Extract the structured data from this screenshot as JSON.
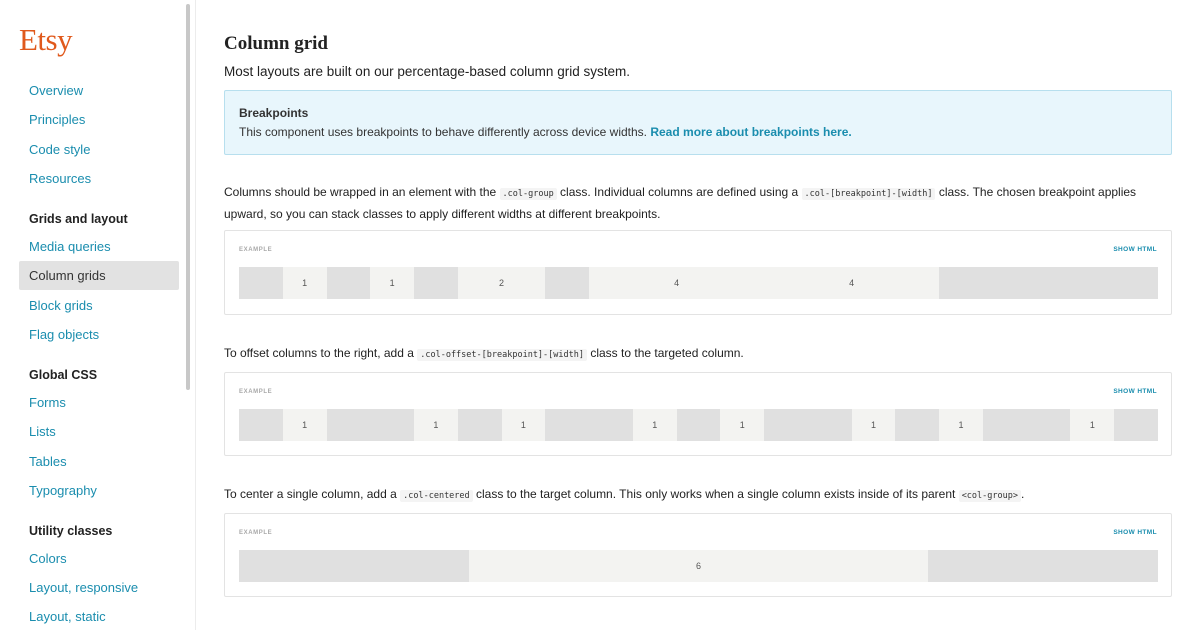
{
  "sidebar": {
    "logo": "Etsy",
    "nav_top": [
      {
        "label": "Overview"
      },
      {
        "label": "Principles"
      },
      {
        "label": "Code style"
      },
      {
        "label": "Resources"
      }
    ],
    "heading_grids": "Grids and layout",
    "nav_grids": [
      {
        "label": "Media queries"
      },
      {
        "label": "Column grids"
      },
      {
        "label": "Block grids"
      },
      {
        "label": "Flag objects"
      }
    ],
    "heading_css": "Global CSS",
    "nav_css": [
      {
        "label": "Forms"
      },
      {
        "label": "Lists"
      },
      {
        "label": "Tables"
      },
      {
        "label": "Typography"
      }
    ],
    "heading_utility": "Utility classes",
    "nav_utility": [
      {
        "label": "Colors"
      },
      {
        "label": "Layout, responsive"
      },
      {
        "label": "Layout, static"
      }
    ]
  },
  "main": {
    "title": "Column grid",
    "intro": "Most layouts are built on our percentage-based column grid system.",
    "callout": {
      "title": "Breakpoints",
      "body": "This component uses breakpoints to behave differently across device widths.",
      "link": "Read more about breakpoints here."
    },
    "para1": {
      "t1": "Columns should be wrapped in an element with the",
      "c1": ".col-group",
      "t2": "class. Individual columns are defined using a",
      "c2": ".col-[breakpoint]-[width]",
      "t3": "class. The chosen breakpoint applies upward, so you can stack classes to apply different widths at different breakpoints."
    },
    "para2": {
      "t1": "To offset columns to the right, add a",
      "c1": ".col-offset-[breakpoint]-[width]",
      "t2": "class to the targeted column."
    },
    "para3": {
      "t1": "To center a single column, add a",
      "c1": ".col-centered",
      "t2": "class to the target column. This only works when a single column exists inside of its parent",
      "c2": "<col-group>",
      "t3": "."
    },
    "example_label": "EXAMPLE",
    "show_html_label": "SHOW HTML",
    "examples": [
      {
        "cells": [
          {
            "label": "1",
            "start": 1,
            "span": 1
          },
          {
            "label": "1",
            "start": 3,
            "span": 1
          },
          {
            "label": "2",
            "start": 5,
            "span": 2
          },
          {
            "label": "4",
            "start": 8,
            "span": 4
          },
          {
            "label": "4",
            "start": 12,
            "span": 4
          }
        ]
      },
      {
        "cells": [
          {
            "label": "1",
            "start": 1,
            "span": 1
          },
          {
            "label": "1",
            "start": 4,
            "span": 1
          },
          {
            "label": "1",
            "start": 6,
            "span": 1
          },
          {
            "label": "1",
            "start": 9,
            "span": 1
          },
          {
            "label": "1",
            "start": 11,
            "span": 1
          },
          {
            "label": "1",
            "start": 14,
            "span": 1
          },
          {
            "label": "1",
            "start": 16,
            "span": 1
          },
          {
            "label": "1",
            "start": 19,
            "span": 1
          }
        ]
      },
      {
        "cells": [
          {
            "label": "6",
            "start": 3,
            "span": 6
          }
        ]
      }
    ],
    "example_columns": [
      21,
      21,
      12
    ]
  }
}
